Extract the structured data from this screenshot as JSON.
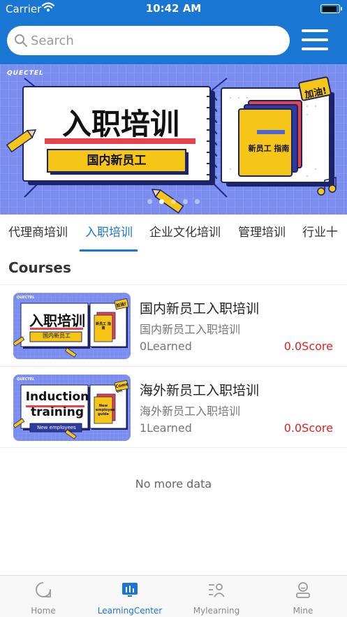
{
  "status_bar": {
    "carrier": "Carrier",
    "time": "10:42 AM",
    "battery_level": 0.95
  },
  "search": {
    "placeholder": "Search",
    "value": ""
  },
  "banner": {
    "brand": "QUECTEL",
    "title": "入职培训",
    "subtitle": "国内新员工",
    "book_text": "新员工 指南",
    "badge": "加油!",
    "slide_count": 5,
    "active_slide": 1
  },
  "tabs": [
    {
      "label": "代理商培训",
      "active": false
    },
    {
      "label": "入职培训",
      "active": true
    },
    {
      "label": "企业文化培训",
      "active": false
    },
    {
      "label": "管理培训",
      "active": false
    },
    {
      "label": "行业十",
      "active": false
    }
  ],
  "section_title": "Courses",
  "courses": [
    {
      "title": "国内新员工入职培训",
      "subtitle": "国内新员工入职培训",
      "learned": "0Learned",
      "score": "0.0Score",
      "thumb": {
        "brand": "QUECTEL",
        "title": "入职培训",
        "sub": "国内新员工",
        "book": "新员工 指南",
        "badge": "加油!"
      }
    },
    {
      "title": "海外新员工入职培训",
      "subtitle": "海外新员工入职培训",
      "learned": "1Learned",
      "score": "0.0Score",
      "thumb": {
        "brand": "QUECTEL",
        "title_line1": "Induction",
        "title_line2": "training",
        "sub": "New employees",
        "book": "New employee guide",
        "badge": "Come on"
      }
    }
  ],
  "no_more": "No more data",
  "bottom_nav": [
    {
      "label": "Home",
      "icon": "home-icon",
      "active": false
    },
    {
      "label": "LearningCenter",
      "icon": "learning-center-icon",
      "active": true
    },
    {
      "label": "Mylearning",
      "icon": "my-learning-icon",
      "active": false
    },
    {
      "label": "Mine",
      "icon": "user-icon",
      "active": false
    }
  ],
  "colors": {
    "primary": "#1976d2",
    "banner_bg": "#7b8ef0",
    "score": "#e02020",
    "highlight_yellow": "#f5c518",
    "accent_red": "#e8434c"
  }
}
